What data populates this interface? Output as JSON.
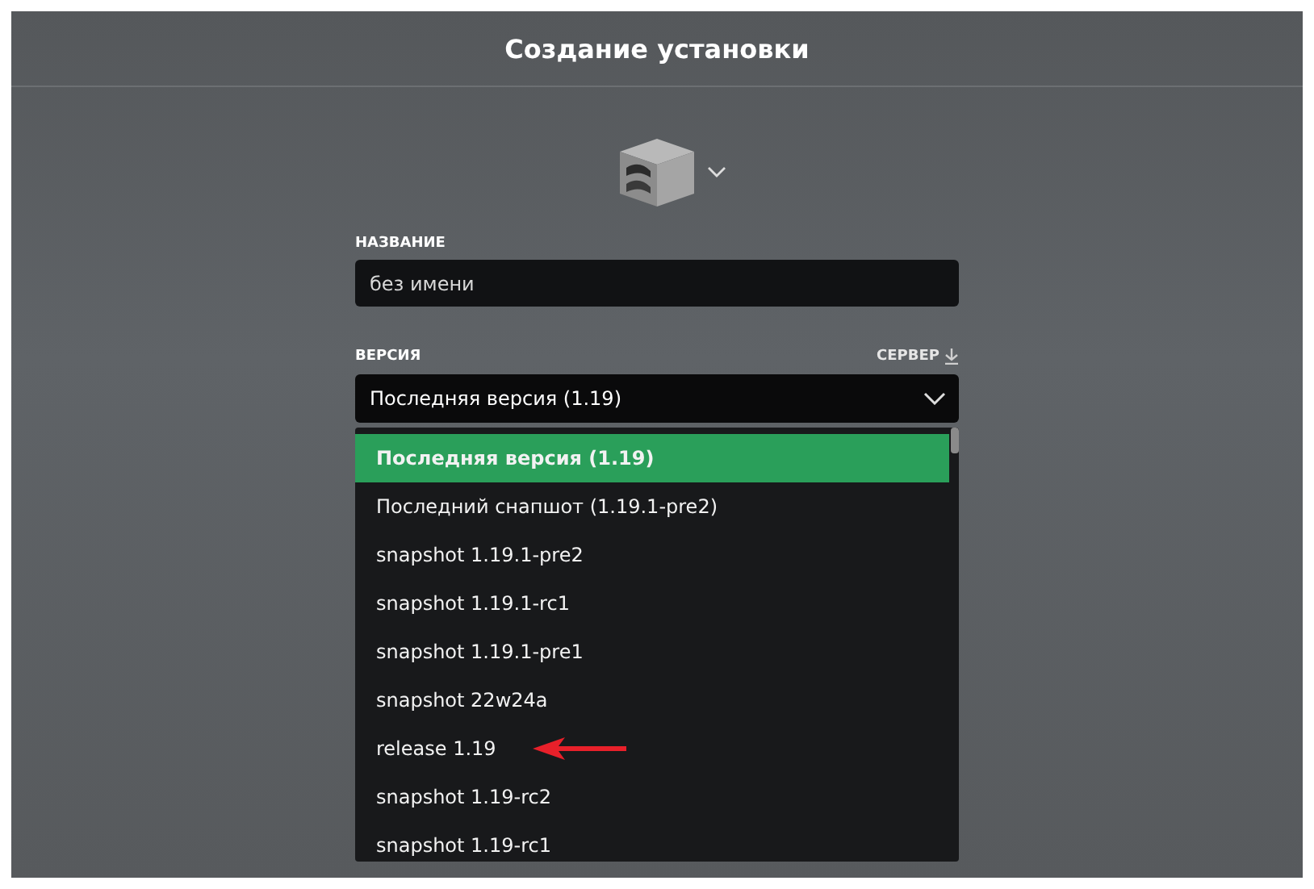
{
  "header": {
    "title": "Создание установки"
  },
  "name_field": {
    "label": "НАЗВАНИЕ",
    "value": "без имени"
  },
  "version_field": {
    "label": "ВЕРСИЯ",
    "server_link": "СЕРВЕР",
    "value": "Последняя версия (1.19)"
  },
  "version_list": [
    {
      "label": "Последняя версия (1.19)",
      "selected": true,
      "marked": false
    },
    {
      "label": "Последний снапшот (1.19.1-pre2)",
      "selected": false,
      "marked": false
    },
    {
      "label": "snapshot 1.19.1-pre2",
      "selected": false,
      "marked": false
    },
    {
      "label": "snapshot 1.19.1-rc1",
      "selected": false,
      "marked": false
    },
    {
      "label": "snapshot 1.19.1-pre1",
      "selected": false,
      "marked": false
    },
    {
      "label": "snapshot 22w24a",
      "selected": false,
      "marked": false
    },
    {
      "label": "release 1.19",
      "selected": false,
      "marked": true
    },
    {
      "label": "snapshot 1.19-rc2",
      "selected": false,
      "marked": false
    },
    {
      "label": "snapshot 1.19-rc1",
      "selected": false,
      "marked": false
    }
  ]
}
